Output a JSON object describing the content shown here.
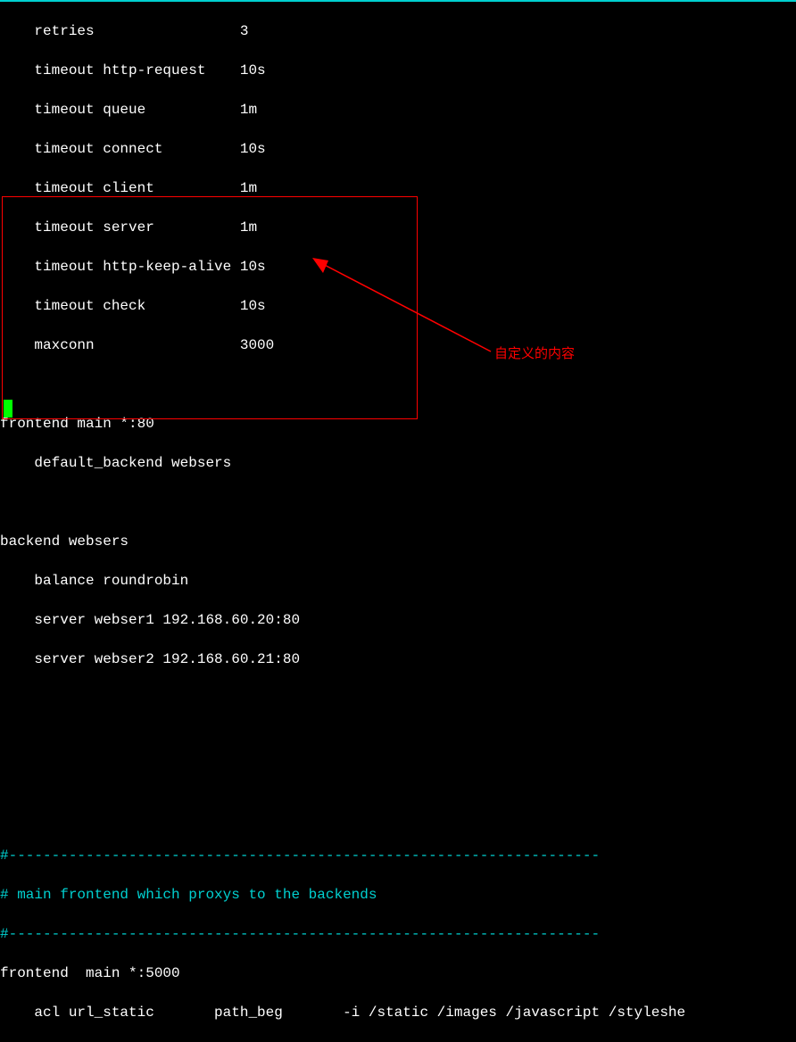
{
  "top_config": {
    "lines": [
      "    retries                 3",
      "    timeout http-request    10s",
      "    timeout queue           1m",
      "    timeout connect         10s",
      "    timeout client          1m",
      "    timeout server          1m",
      "    timeout http-keep-alive 10s",
      "    timeout check           10s",
      "    maxconn                 3000"
    ]
  },
  "custom_block": {
    "lines": [
      "",
      "frontend main *:80",
      "    default_backend websers",
      "",
      "backend websers",
      "    balance roundrobin",
      "    server webser1 192.168.60.20:80",
      "    server webser2 192.168.60.21:80",
      "",
      ""
    ]
  },
  "annotation_label": "自定义的内容",
  "bottom_section": {
    "sep1": "#---------------------------------------------------------------------",
    "comment": "# main frontend which proxys to the backends",
    "sep2": "#---------------------------------------------------------------------",
    "frontend": "frontend  main *:5000",
    "acl": "    acl url_static       path_beg       -i /static /images /javascript /styleshe"
  }
}
